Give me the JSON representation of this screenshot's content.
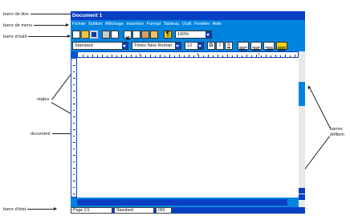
{
  "labels": {
    "title_bar": "barre de titre",
    "menu_bar": "barre de menu",
    "toolbar": "barre d'outil",
    "rulers": "règles",
    "document": "document",
    "scrollbars_line1": "barres",
    "scrollbars_line2": "défilem",
    "status_bar": "barre d'état"
  },
  "window": {
    "title": "Document 1",
    "menu": [
      "Fichier",
      "Edition",
      "Affichage",
      "Insertion",
      "Format",
      "Tableau",
      "Outil",
      "Fenêtre",
      "Aide"
    ]
  },
  "toolbar": {
    "zoom": "100%"
  },
  "format_bar": {
    "style": "Standard",
    "font": "Times New Roman",
    "size": "12",
    "bold": "G",
    "italic": "I",
    "underline": "S"
  },
  "ruler": {
    "marks": [
      "1",
      "2",
      "3"
    ]
  },
  "status": {
    "page": "Page 1/1",
    "style": "Standard",
    "mode": "INS"
  },
  "colors": {
    "title_bar": "#0a3fc4",
    "menu_bar": "#0084e0",
    "page": "#ffffff"
  }
}
